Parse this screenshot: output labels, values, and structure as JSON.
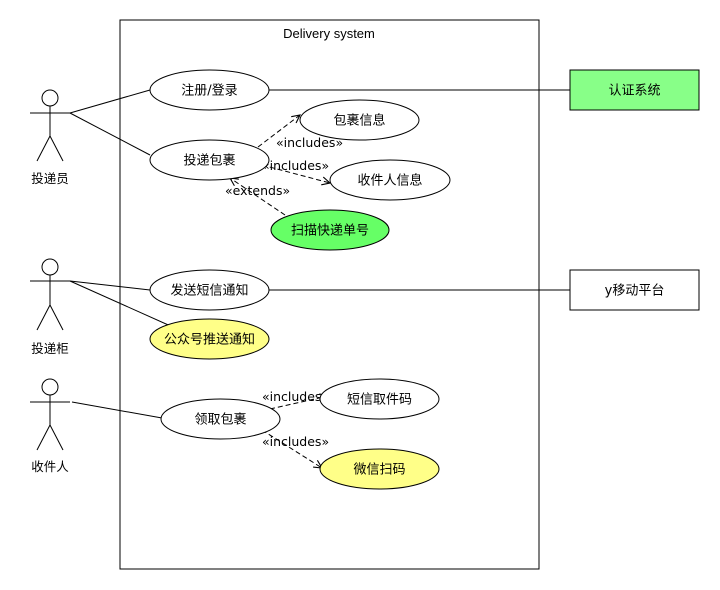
{
  "system_title": "Delivery system",
  "colors": {
    "usecase_default": "#ffffff",
    "usecase_highlight_yellow": "#ffff88",
    "usecase_highlight_green": "#66ff66",
    "external_green": "#88ff88",
    "external_white": "#ffffff",
    "stroke": "#000000"
  },
  "actors": [
    {
      "id": "courier",
      "label": "投递员"
    },
    {
      "id": "locker",
      "label": "投递柜"
    },
    {
      "id": "recipient",
      "label": "收件人"
    }
  ],
  "usecases": [
    {
      "id": "register",
      "label": "注册/登录",
      "fill": "default"
    },
    {
      "id": "deliver",
      "label": "投递包裹",
      "fill": "default"
    },
    {
      "id": "package_info",
      "label": "包裹信息",
      "fill": "default"
    },
    {
      "id": "recipient_info",
      "label": "收件人信息",
      "fill": "default"
    },
    {
      "id": "scan",
      "label": "扫描快递单号",
      "fill": "green"
    },
    {
      "id": "sms_notify",
      "label": "发送短信通知",
      "fill": "default"
    },
    {
      "id": "wechat_push",
      "label": "公众号推送通知",
      "fill": "yellow"
    },
    {
      "id": "pickup",
      "label": "领取包裹",
      "fill": "default"
    },
    {
      "id": "sms_code",
      "label": "短信取件码",
      "fill": "default"
    },
    {
      "id": "wechat_scan",
      "label": "微信扫码",
      "fill": "yellow"
    }
  ],
  "external_systems": [
    {
      "id": "auth",
      "label": "认证系统",
      "fill": "green"
    },
    {
      "id": "mobile",
      "label": "y移动平台",
      "fill": "white"
    }
  ],
  "relations": {
    "includes_label": "«includes»",
    "extends_label": "«extends»"
  }
}
